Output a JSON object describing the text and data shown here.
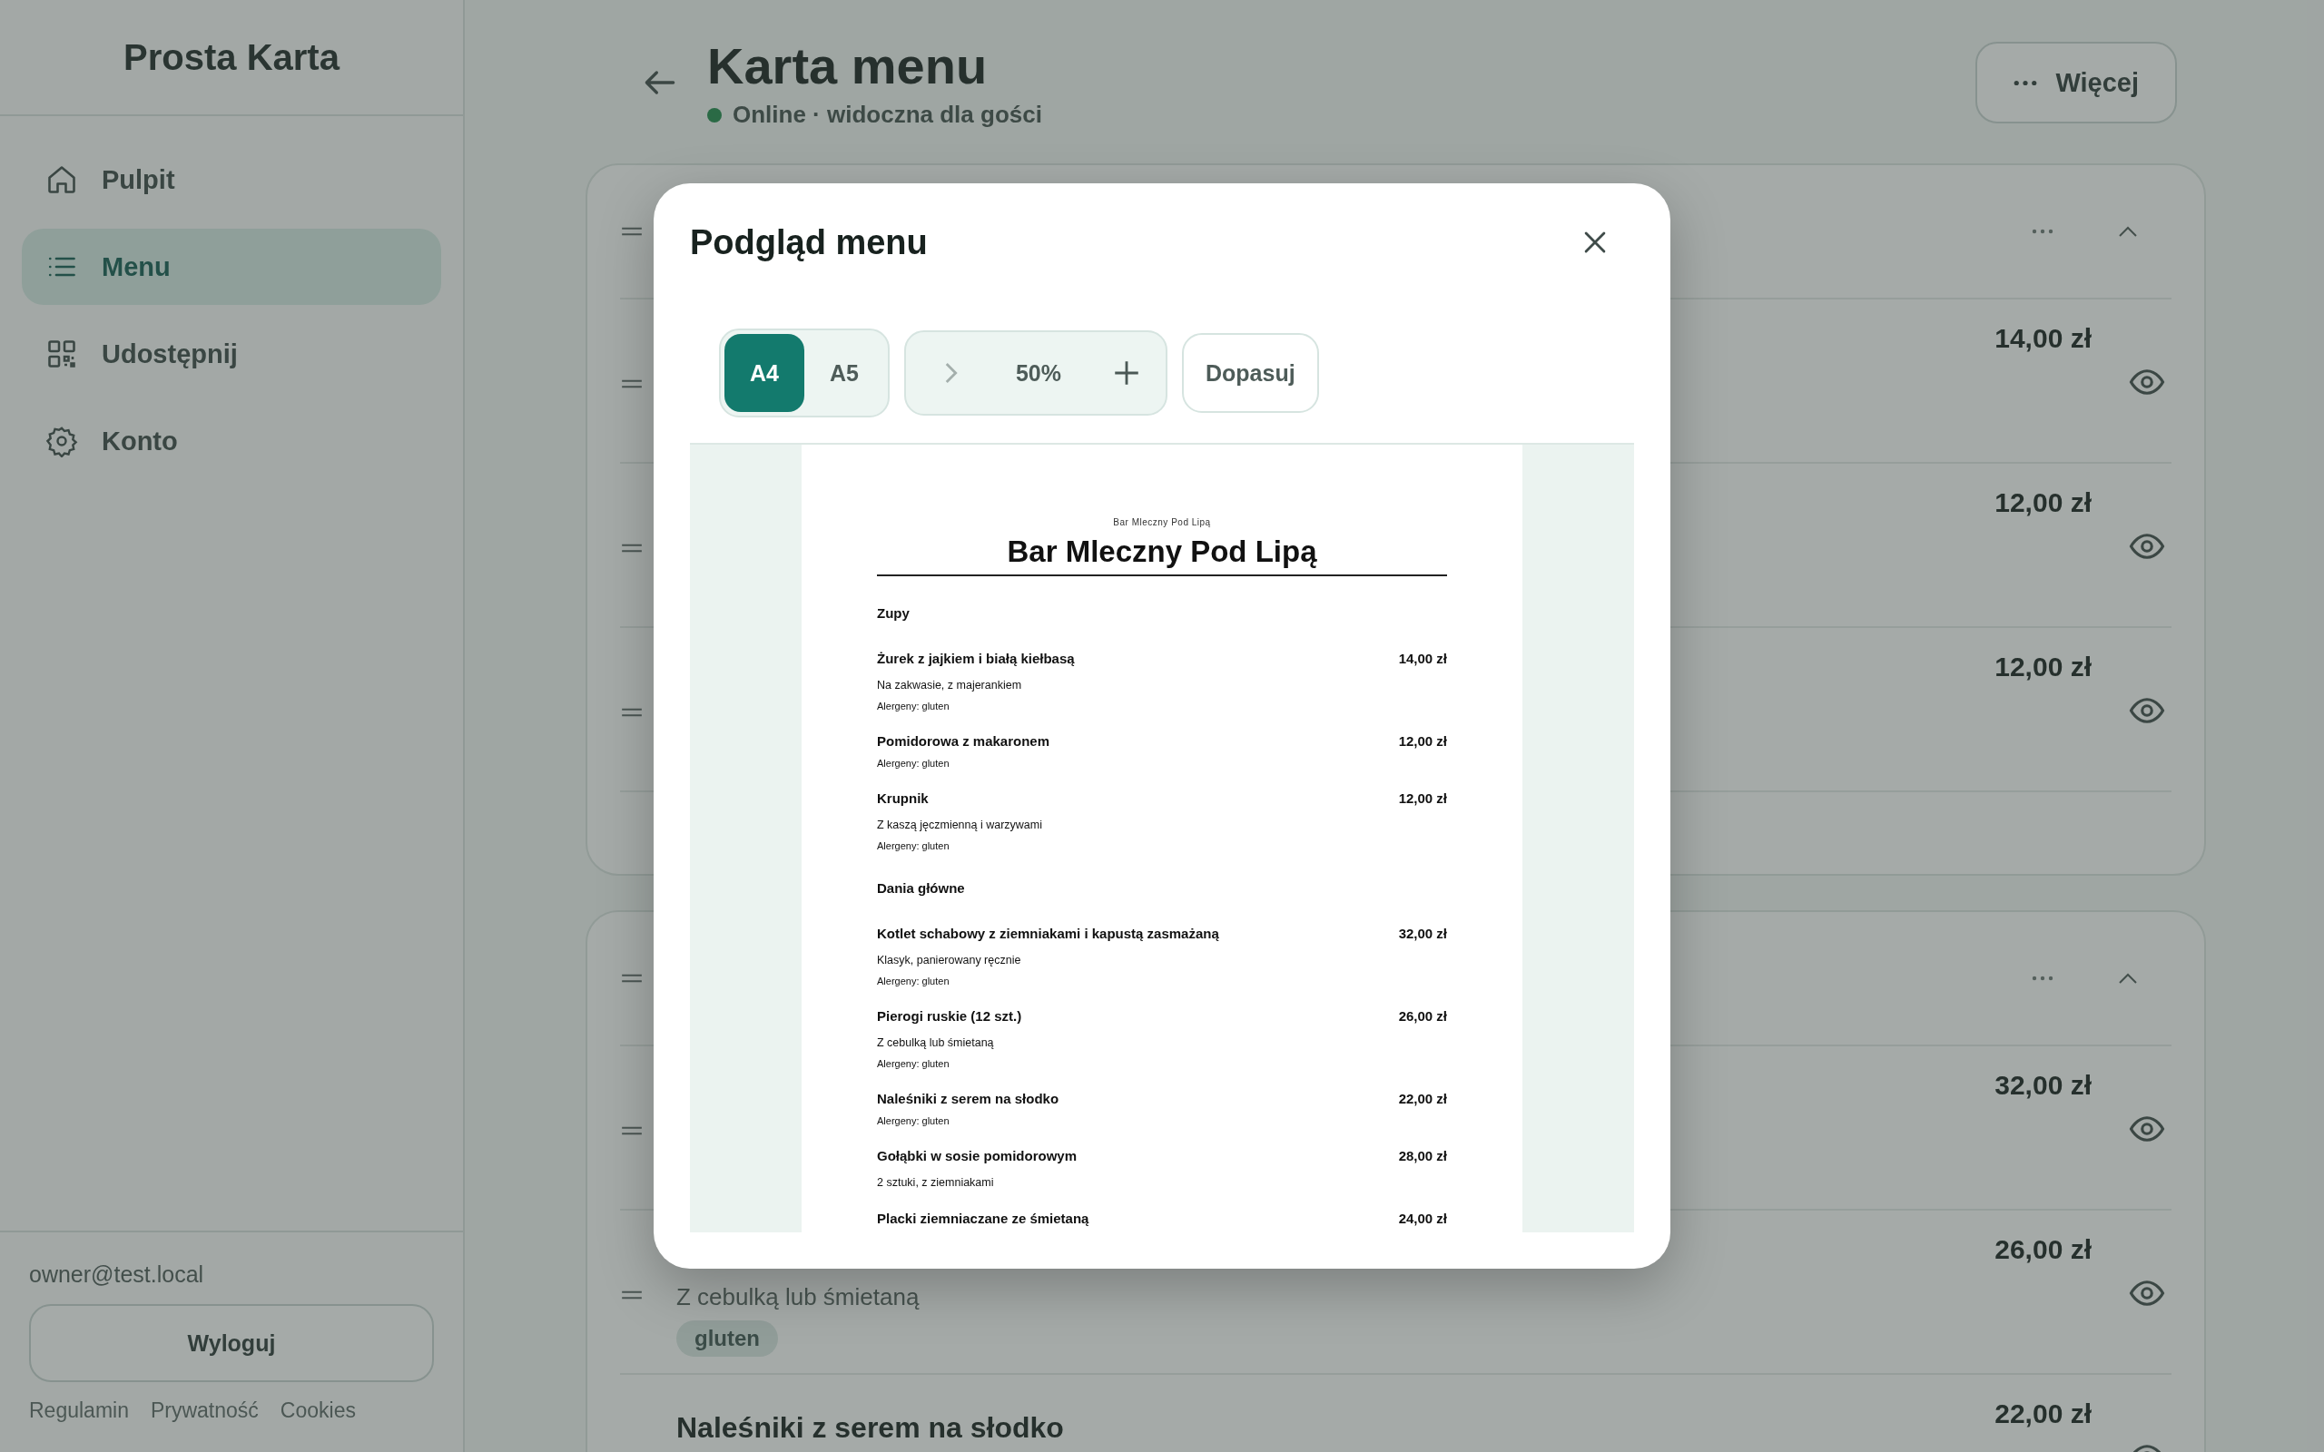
{
  "sidebar": {
    "brand": "Prosta Karta",
    "items": [
      {
        "label": "Pulpit",
        "selected": false
      },
      {
        "label": "Menu",
        "selected": true
      },
      {
        "label": "Udostępnij",
        "selected": false
      },
      {
        "label": "Konto",
        "selected": false
      }
    ],
    "user_email": "owner@test.local",
    "logout": "Wyloguj",
    "footer_links": [
      "Regulamin",
      "Prywatność",
      "Cookies"
    ]
  },
  "header": {
    "title": "Karta menu",
    "status": "Online · widoczna dla gości",
    "online": true,
    "more_button": "Więcej"
  },
  "categories": [
    {
      "expanded": true,
      "items": [
        {
          "price": "14,00 zł",
          "visible": true
        },
        {
          "price": "12,00 zł",
          "visible": true
        },
        {
          "price": "12,00 zł",
          "visible": true
        }
      ]
    },
    {
      "expanded": true,
      "items": [
        {
          "price": "32,00 zł",
          "visible": true
        },
        {
          "price": "26,00 zł",
          "visible": true,
          "description": "Z cebulką lub śmietaną",
          "tags": [
            "gluten"
          ]
        },
        {
          "name": "Naleśniki z serem na słodko",
          "price": "22,00 zł",
          "visible": true
        }
      ]
    }
  ],
  "modal": {
    "title": "Podgląd menu",
    "formats": [
      {
        "label": "A4",
        "selected": true
      },
      {
        "label": "A5",
        "selected": false
      }
    ],
    "zoom": "50%",
    "fit_button": "Dopasuj",
    "preview": {
      "small_title": "Bar Mleczny Pod Lipą",
      "title": "Bar Mleczny Pod Lipą",
      "sections": [
        {
          "name": "Zupy",
          "items": [
            {
              "name": "Żurek z jajkiem i białą kiełbasą",
              "price": "14,00 zł",
              "description": "Na zakwasie, z majerankiem",
              "allergens": "Alergeny: gluten"
            },
            {
              "name": "Pomidorowa z makaronem",
              "price": "12,00 zł",
              "allergens": "Alergeny: gluten"
            },
            {
              "name": "Krupnik",
              "price": "12,00 zł",
              "description": "Z kaszą jęczmienną i warzywami",
              "allergens": "Alergeny: gluten"
            }
          ]
        },
        {
          "name": "Dania główne",
          "items": [
            {
              "name": "Kotlet schabowy z ziemniakami i kapustą zasmażaną",
              "price": "32,00 zł",
              "description": "Klasyk, panierowany ręcznie",
              "allergens": "Alergeny: gluten"
            },
            {
              "name": "Pierogi ruskie (12 szt.)",
              "price": "26,00 zł",
              "description": "Z cebulką lub śmietaną",
              "allergens": "Alergeny: gluten"
            },
            {
              "name": "Naleśniki z serem na słodko",
              "price": "22,00 zł",
              "allergens": "Alergeny: gluten"
            },
            {
              "name": "Gołąbki w sosie pomidorowym",
              "price": "28,00 zł",
              "description": "2 sztuki, z ziemniakami"
            },
            {
              "name": "Placki ziemniaczane ze śmietaną",
              "price": "24,00 zł"
            }
          ]
        }
      ]
    }
  }
}
